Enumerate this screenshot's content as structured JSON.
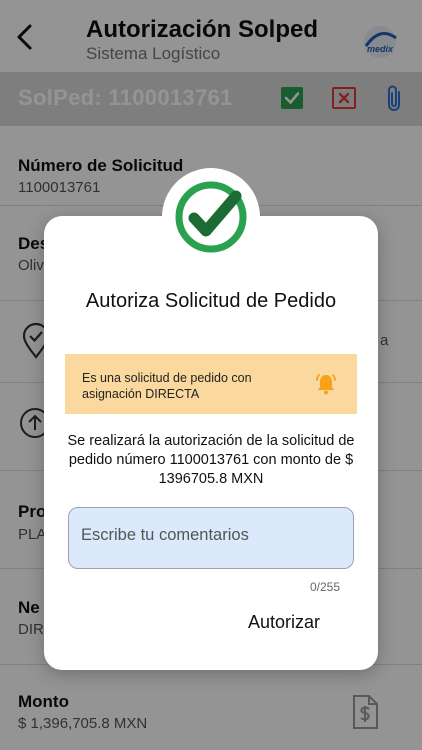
{
  "header": {
    "title": "Autorización Solped",
    "subtitle": "Sistema Logístico",
    "logo_text": "medix"
  },
  "solped_bar": {
    "label": "SolPed: 1100013761"
  },
  "fields": [
    {
      "label": "Número de Solicitud",
      "value": "1100013761"
    },
    {
      "label": "Des",
      "value": "Oliv"
    },
    {
      "label": "",
      "value": "a"
    },
    {
      "label": "Pro",
      "value": "PLA"
    },
    {
      "label": "Ne",
      "value": "DIR"
    },
    {
      "label": "Monto",
      "value": "$ 1,396,705.8 MXN"
    }
  ],
  "dialog": {
    "title": "Autoriza Solicitud de Pedido",
    "alert_text": "Es una solicitud de pedido con asignación DIRECTA",
    "message": "Se realizará la autorización de la solicitud de pedido número 1100013761 con monto de  $ 1396705.8 MXN",
    "comment_placeholder": "Escribe tu comentarios",
    "comment_value": "",
    "counter": "0/255",
    "authorize_label": "Autorizar"
  },
  "colors": {
    "accent_green": "#2aa14e",
    "reject_red": "#e03a3a",
    "alert_bg": "#fbd89e",
    "bell_orange": "#f6a21a",
    "input_bg": "#dbe9fb"
  },
  "icons": {
    "back": "chevron-left-icon",
    "approve": "check-square-icon",
    "reject": "x-square-icon",
    "attach": "paperclip-icon",
    "location": "map-pin-check-icon",
    "upload": "upload-circle-icon",
    "document": "document-dollar-icon",
    "success": "check-circle-icon",
    "bell": "bell-ring-icon"
  }
}
